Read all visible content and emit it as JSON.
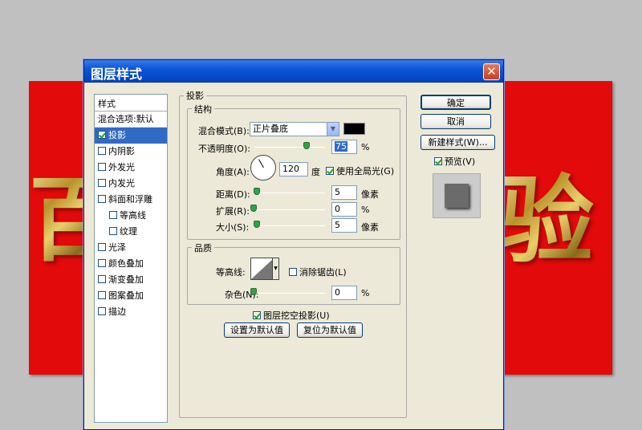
{
  "canvas": {
    "bg_color": "#e20a0a",
    "left_glyph": "百",
    "right_glyph": "验"
  },
  "dialog": {
    "title": "图层样式",
    "close_icon": "close-icon"
  },
  "sidebar": {
    "header": "样式",
    "items": [
      {
        "label": "混合选项:默认",
        "checkbox": false,
        "selected": false
      },
      {
        "label": "投影",
        "checkbox": true,
        "checked": true,
        "selected": true
      },
      {
        "label": "内阴影",
        "checkbox": true,
        "checked": false
      },
      {
        "label": "外发光",
        "checkbox": true,
        "checked": false
      },
      {
        "label": "内发光",
        "checkbox": true,
        "checked": false
      },
      {
        "label": "斜面和浮雕",
        "checkbox": true,
        "checked": false
      },
      {
        "label": "等高线",
        "checkbox": true,
        "checked": false,
        "indent": true
      },
      {
        "label": "纹理",
        "checkbox": true,
        "checked": false,
        "indent": true
      },
      {
        "label": "光泽",
        "checkbox": true,
        "checked": false
      },
      {
        "label": "颜色叠加",
        "checkbox": true,
        "checked": false
      },
      {
        "label": "渐变叠加",
        "checkbox": true,
        "checked": false
      },
      {
        "label": "图案叠加",
        "checkbox": true,
        "checked": false
      },
      {
        "label": "描边",
        "checkbox": true,
        "checked": false
      }
    ]
  },
  "panel": {
    "title": "投影",
    "structure": {
      "title": "结构",
      "blend_mode_label": "混合模式(B):",
      "blend_mode_value": "正片叠底",
      "shadow_color": "#000000",
      "opacity_label": "不透明度(O):",
      "opacity_value": "75",
      "percent": "%",
      "angle_label": "角度(A):",
      "angle_value": "120",
      "degree_unit": "度",
      "global_light_label": "使用全局光(G)",
      "distance_label": "距离(D):",
      "distance_value": "5",
      "spread_label": "扩展(R):",
      "spread_value": "0",
      "size_label": "大小(S):",
      "size_value": "5",
      "px_unit": "像素"
    },
    "quality": {
      "title": "品质",
      "contour_label": "等高线:",
      "antialias_label": "消除锯齿(L)",
      "noise_label": "杂色(N):",
      "noise_value": "0"
    },
    "knockout_label": "图层挖空投影(U)",
    "make_default_label": "设置为默认值",
    "reset_default_label": "复位为默认值"
  },
  "right": {
    "ok_label": "确定",
    "cancel_label": "取消",
    "new_style_label": "新建样式(W)...",
    "preview_label": "预览(V)"
  }
}
